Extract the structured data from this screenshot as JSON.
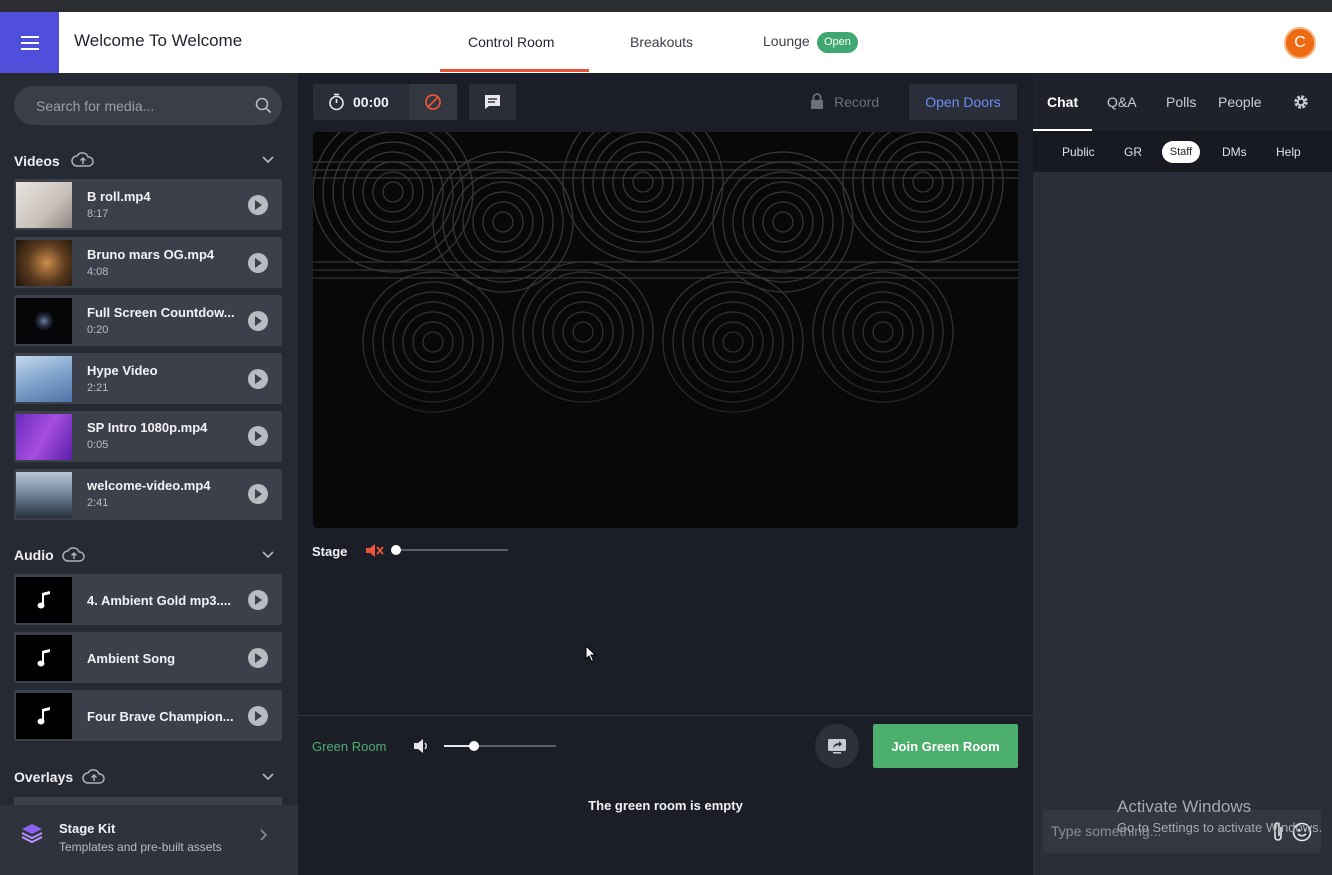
{
  "header": {
    "event_title": "Welcome To Welcome",
    "tabs": [
      {
        "label": "Control Room",
        "active": true
      },
      {
        "label": "Breakouts",
        "active": false
      },
      {
        "label": "Lounge",
        "active": false,
        "badge": "Open"
      }
    ],
    "avatar_initial": "C",
    "accent_color": "#e8553a",
    "menu_color": "#4f4fdb"
  },
  "media": {
    "search_placeholder": "Search for media...",
    "videos": {
      "title": "Videos",
      "items": [
        {
          "name": "B roll.mp4",
          "duration": "8:17"
        },
        {
          "name": "Bruno mars OG.mp4",
          "duration": "4:08"
        },
        {
          "name": "Full Screen Countdow...",
          "duration": "0:20"
        },
        {
          "name": "Hype Video",
          "duration": "2:21"
        },
        {
          "name": "SP Intro 1080p.mp4",
          "duration": "0:05"
        },
        {
          "name": "welcome-video.mp4",
          "duration": "2:41"
        }
      ]
    },
    "audio": {
      "title": "Audio",
      "items": [
        {
          "name": "4. Ambient Gold mp3...."
        },
        {
          "name": "Ambient Song"
        },
        {
          "name": "Four Brave Champion..."
        }
      ]
    },
    "overlays": {
      "title": "Overlays"
    },
    "stage_kit": {
      "title": "Stage Kit",
      "subtitle": "Templates and pre-built assets"
    }
  },
  "stage": {
    "timer": "00:00",
    "record_label": "Record",
    "open_doors_label": "Open Doors",
    "stage_label": "Stage",
    "stage_volume": 0.0,
    "green_room_label": "Green Room",
    "green_room_volume": 0.27,
    "join_label": "Join Green Room",
    "empty_message": "The green room is empty"
  },
  "chat": {
    "tabs": [
      "Chat",
      "Q&A",
      "Polls",
      "People"
    ],
    "active_tab": "Chat",
    "sub_tabs": [
      "Public",
      "GR",
      "Staff",
      "DMs",
      "Help"
    ],
    "active_sub_tab": "Staff",
    "input_placeholder": "Type something..."
  },
  "system_overlay": {
    "title": "Activate Windows",
    "subtitle": "Go to Settings to activate Windows."
  }
}
